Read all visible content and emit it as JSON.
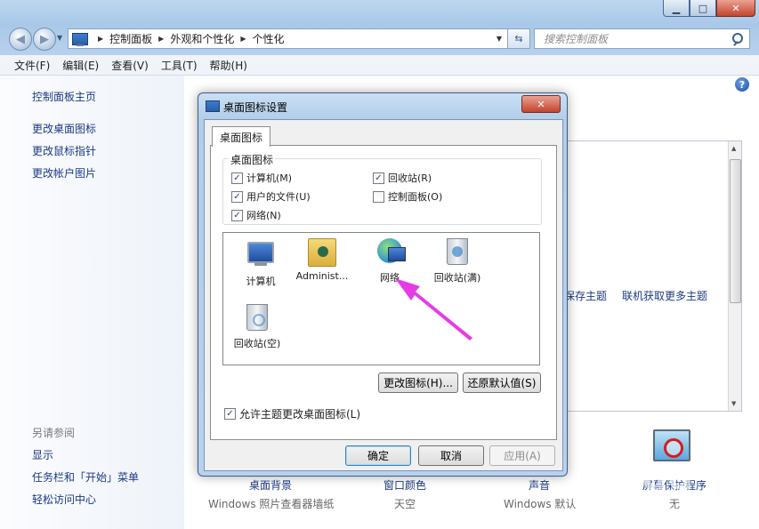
{
  "window": {
    "buttons": {
      "min": "▁",
      "max": "□",
      "close": "✕"
    }
  },
  "nav": {
    "breadcrumbs": [
      "控制面板",
      "外观和个性化",
      "个性化"
    ],
    "search_placeholder": "搜索控制面板"
  },
  "menu": [
    "文件(F)",
    "编辑(E)",
    "查看(V)",
    "工具(T)",
    "帮助(H)"
  ],
  "leftpane": {
    "home": "控制面板主页",
    "links": [
      "更改桌面图标",
      "更改鼠标指针",
      "更改帐户图片"
    ],
    "see_also": "另请参阅",
    "see_also_links": [
      "显示",
      "任务栏和「开始」菜单",
      "轻松访问中心"
    ]
  },
  "main": {
    "theme_links": [
      "保存主题",
      "联机获取更多主题"
    ],
    "bottom": [
      {
        "label": "桌面背景",
        "sub": "Windows 照片查看器墙纸"
      },
      {
        "label": "窗口颜色",
        "sub": "天空"
      },
      {
        "label": "声音",
        "sub": "Windows 默认"
      },
      {
        "label": "屏幕保护程序",
        "sub": "无"
      }
    ]
  },
  "dialog": {
    "title": "桌面图标设置",
    "tab": "桌面图标",
    "group_label": "桌面图标",
    "checkboxes": [
      {
        "label": "计算机(M)",
        "checked": true
      },
      {
        "label": "回收站(R)",
        "checked": true
      },
      {
        "label": "用户的文件(U)",
        "checked": true
      },
      {
        "label": "控制面板(O)",
        "checked": false
      },
      {
        "label": "网络(N)",
        "checked": true
      }
    ],
    "icons": [
      "计算机",
      "Administ...",
      "网络",
      "回收站(满)",
      "回收站(空)"
    ],
    "change_icon": "更改图标(H)...",
    "restore_default": "还原默认值(S)",
    "allow_themes": "允许主题更改桌面图标(L)",
    "allow_themes_checked": true,
    "ok": "确定",
    "cancel": "取消",
    "apply": "应用(A)"
  },
  "colors": {
    "link": "#1b3a84",
    "annotation_arrow": "#e63ce6"
  }
}
